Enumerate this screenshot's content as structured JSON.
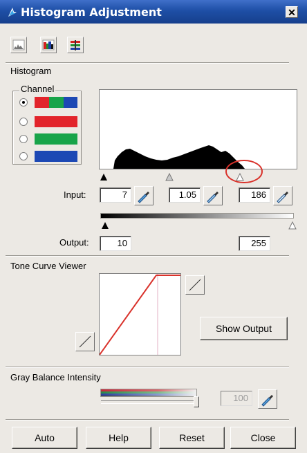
{
  "window": {
    "title": "Histogram Adjustment",
    "close_label": "✕"
  },
  "toolbar": {
    "buttons": [
      "histogram-view",
      "color-view",
      "channel-view"
    ]
  },
  "histogram": {
    "section_label": "Histogram",
    "channel_group_label": "Channel",
    "channels": [
      {
        "name": "rgb",
        "selected": true
      },
      {
        "name": "red",
        "selected": false
      },
      {
        "name": "green",
        "selected": false
      },
      {
        "name": "blue",
        "selected": false
      }
    ],
    "input_label": "Input:",
    "input_black": "7",
    "input_gamma": "1.05",
    "input_white": "186",
    "output_label": "Output:",
    "output_black": "10",
    "output_white": "255"
  },
  "tone_curve": {
    "section_label": "Tone Curve Viewer",
    "show_output_label": "Show Output"
  },
  "gray_balance": {
    "section_label": "Gray Balance Intensity",
    "value": "100"
  },
  "footer": {
    "auto_label": "Auto",
    "help_label": "Help",
    "reset_label": "Reset",
    "close_label": "Close"
  },
  "colors": {
    "title_bar": "#1e4fa6",
    "highlight_circle": "#d9322b",
    "curve_line": "#d9322b"
  }
}
